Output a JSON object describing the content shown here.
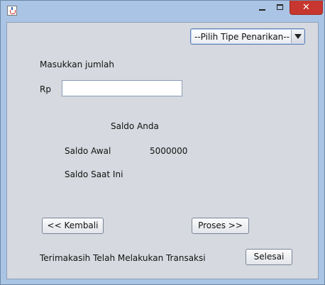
{
  "window": {
    "title": "",
    "controls": {
      "minimize": "minimize",
      "maximize": "maximize",
      "close": "✕"
    }
  },
  "withdrawal_type": {
    "selected": "--Pilih Tipe Penarikan--"
  },
  "amount": {
    "prompt": "Masukkan jumlah",
    "currency": "Rp",
    "value": ""
  },
  "balance": {
    "heading": "Saldo Anda",
    "initial_label": "Saldo Awal",
    "initial_value": "5000000",
    "current_label": "Saldo Saat Ini",
    "current_value": ""
  },
  "buttons": {
    "back": "<< Kembali",
    "process": "Proses >>",
    "finish": "Selesai"
  },
  "footer": {
    "message": "Terimakasih Telah Melakukan Transaksi"
  },
  "colors": {
    "title_bar": "#a9c4e4",
    "panel": "#d6d9df",
    "close_button": "#c7372f"
  }
}
